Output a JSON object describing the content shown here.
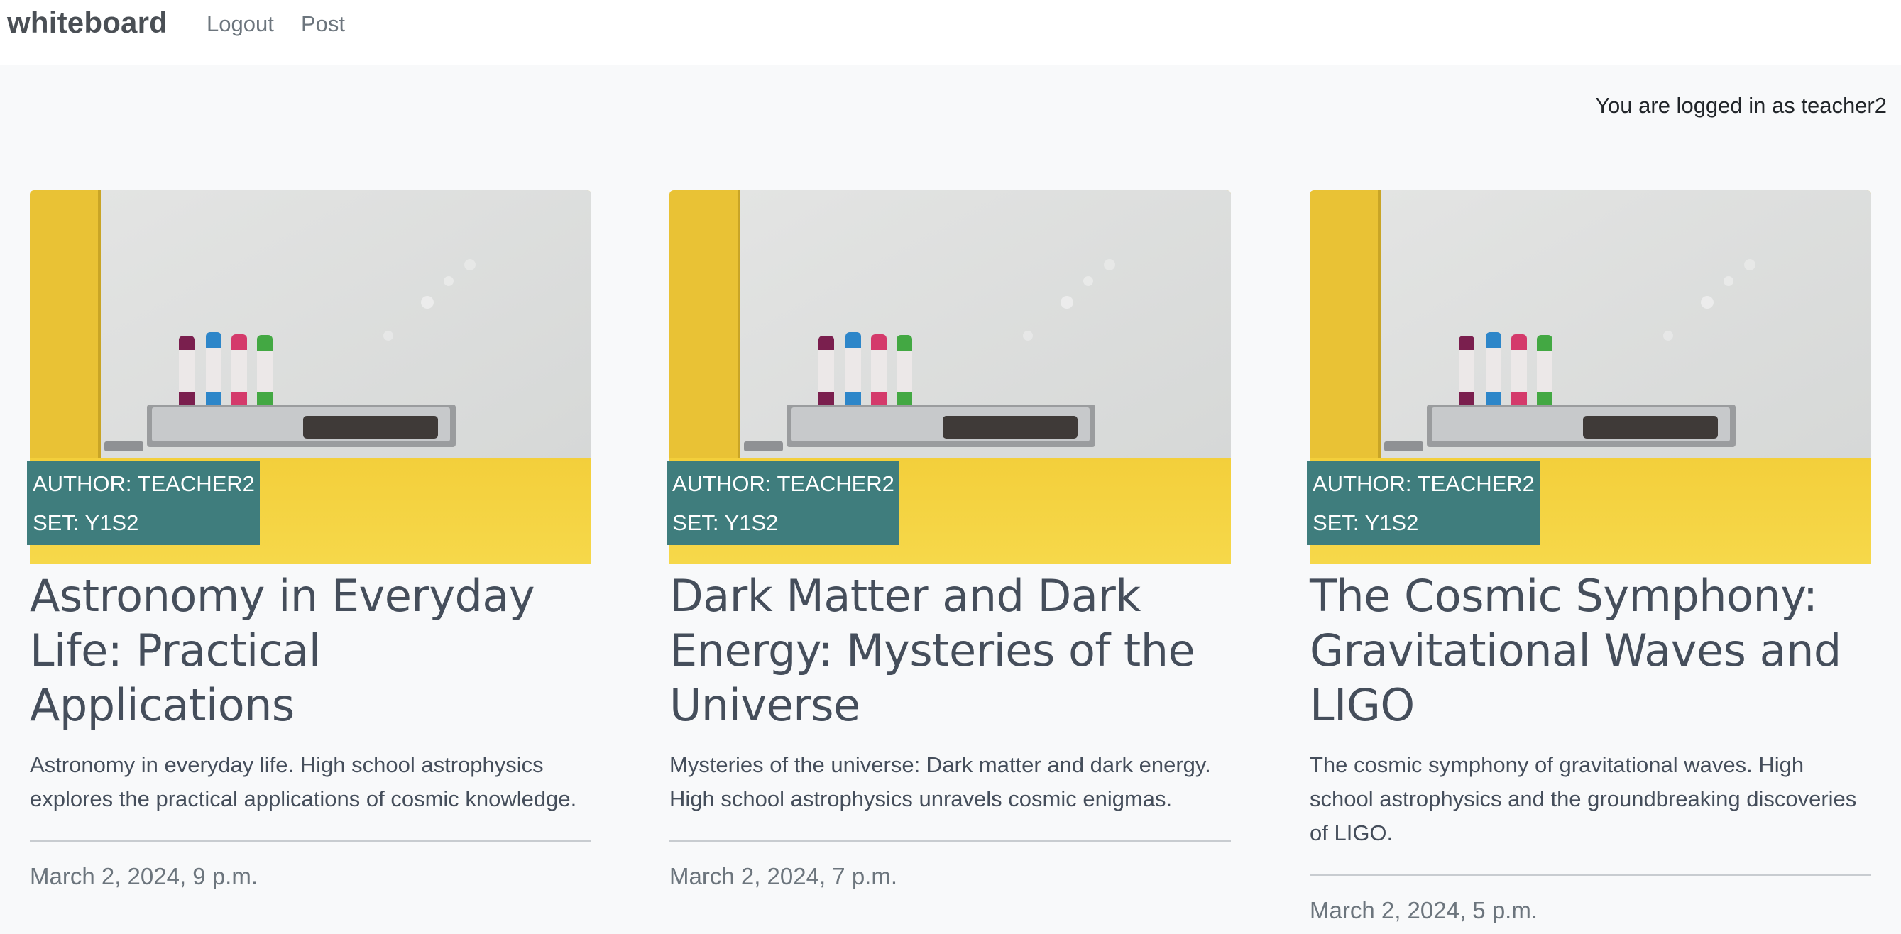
{
  "navbar": {
    "brand": "whiteboard",
    "links": [
      "Logout",
      "Post"
    ]
  },
  "status": {
    "logged_in_text": "You are logged in as teacher2"
  },
  "posts": [
    {
      "author": "AUTHOR: TEACHER2",
      "set": "SET: Y1S2",
      "title": "Astronomy in Everyday Life: Practical Applications",
      "description": "Astronomy in everyday life. High school astrophysics explores the practical applications of cosmic knowledge.",
      "date": "March 2, 2024, 9 p.m."
    },
    {
      "author": "AUTHOR: TEACHER2",
      "set": "SET: Y1S2",
      "title": "Dark Matter and Dark Energy: Mysteries of the Universe",
      "description": "Mysteries of the universe: Dark matter and dark energy. High school astrophysics unravels cosmic enigmas.",
      "date": "March 2, 2024, 7 p.m."
    },
    {
      "author": "AUTHOR: TEACHER2",
      "set": "SET: Y1S2",
      "title": "The Cosmic Symphony: Gravitational Waves and LIGO",
      "description": "The cosmic symphony of gravitational waves. High school astrophysics and the groundbreaking discoveries of LIGO.",
      "date": "March 2, 2024, 5 p.m."
    }
  ],
  "colors": {
    "meta_box": "#3f7d7d",
    "wall_yellow": "#e9c235",
    "board_white": "#dfe0df"
  }
}
